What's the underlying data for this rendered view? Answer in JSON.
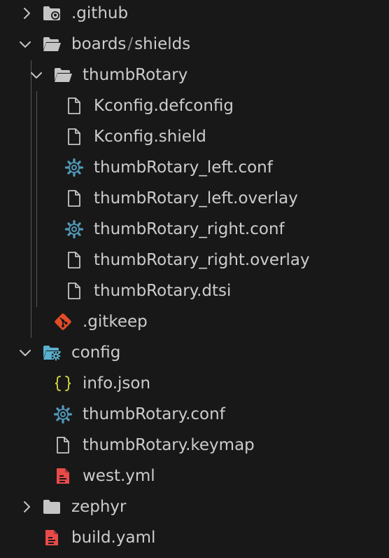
{
  "tree": {
    "github": {
      "label": ".github",
      "icon": "github-folder-icon",
      "expanded": false
    },
    "boards": {
      "label": "boards",
      "separator": "/",
      "label_child": "shields",
      "expanded": true
    },
    "thumbrotary_folder": {
      "label": "thumbRotary",
      "expanded": true
    },
    "shield_files": [
      {
        "label": "Kconfig.defconfig",
        "icon": "file-icon"
      },
      {
        "label": "Kconfig.shield",
        "icon": "file-icon"
      },
      {
        "label": "thumbRotary_left.conf",
        "icon": "gear-icon"
      },
      {
        "label": "thumbRotary_left.overlay",
        "icon": "file-icon"
      },
      {
        "label": "thumbRotary_right.conf",
        "icon": "gear-icon"
      },
      {
        "label": "thumbRotary_right.overlay",
        "icon": "file-icon"
      },
      {
        "label": "thumbRotary.dtsi",
        "icon": "file-icon"
      }
    ],
    "gitkeep": {
      "label": ".gitkeep",
      "icon": "git-icon"
    },
    "config": {
      "label": "config",
      "icon": "config-folder-icon",
      "expanded": true
    },
    "config_files": [
      {
        "label": "info.json",
        "icon": "json-braces-icon"
      },
      {
        "label": "thumbRotary.conf",
        "icon": "gear-icon"
      },
      {
        "label": "thumbRotary.keymap",
        "icon": "file-icon"
      },
      {
        "label": "west.yml",
        "icon": "yaml-file-icon"
      }
    ],
    "zephyr": {
      "label": "zephyr",
      "expanded": false
    },
    "build": {
      "label": "build.yaml",
      "icon": "yaml-file-icon"
    }
  },
  "colors": {
    "background": "#181818",
    "text": "#cccccc",
    "folder": "#c5c5c5",
    "gear": "#519aba",
    "git": "#e34c26",
    "json": "#cbcb41",
    "yaml": "#e84a4a",
    "config_folder": "#5ab0cf"
  }
}
